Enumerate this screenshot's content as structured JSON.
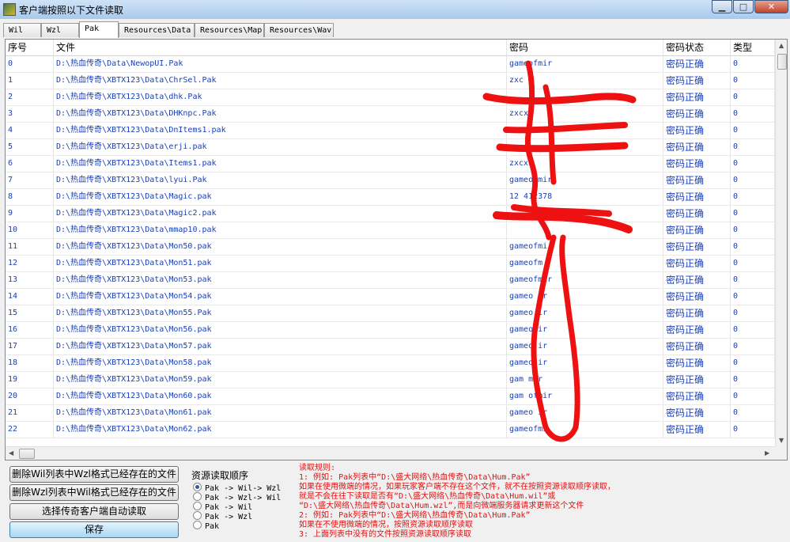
{
  "window": {
    "title": "客户端按照以下文件读取"
  },
  "tabs": [
    {
      "label": "Wil"
    },
    {
      "label": "Wzl"
    },
    {
      "label": "Pak"
    },
    {
      "label": "Resources\\Data"
    },
    {
      "label": "Resources\\Map"
    },
    {
      "label": "Resources\\Wav"
    }
  ],
  "active_tab": "Pak",
  "table": {
    "columns": [
      "序号",
      "文件",
      "密码",
      "密码状态",
      "类型"
    ],
    "rows": [
      {
        "no": "0",
        "file": "D:\\热血传奇\\Data\\NewopUI.Pak",
        "password": "gameofmir",
        "status": "密码正确",
        "type": "0"
      },
      {
        "no": "1",
        "file": "D:\\热血传奇\\XBTX123\\Data\\ChrSel.Pak",
        "password": "zxc",
        "status": "密码正确",
        "type": "0"
      },
      {
        "no": "2",
        "file": "D:\\热血传奇\\XBTX123\\Data\\dhk.Pak",
        "password": "",
        "status": "密码正确",
        "type": "0"
      },
      {
        "no": "3",
        "file": "D:\\热血传奇\\XBTX123\\Data\\DHKnpc.Pak",
        "password": "zxcxz",
        "status": "密码正确",
        "type": "0"
      },
      {
        "no": "4",
        "file": "D:\\热血传奇\\XBTX123\\Data\\DnItems1.pak",
        "password": "zx",
        "status": "密码正确",
        "type": "0"
      },
      {
        "no": "5",
        "file": "D:\\热血传奇\\XBTX123\\Data\\erji.pak",
        "password": "",
        "status": "密码正确",
        "type": "0"
      },
      {
        "no": "6",
        "file": "D:\\热血传奇\\XBTX123\\Data\\Items1.pak",
        "password": "zxcxz",
        "status": "密码正确",
        "type": "0"
      },
      {
        "no": "7",
        "file": "D:\\热血传奇\\XBTX123\\Data\\lyui.Pak",
        "password": "gameofmir",
        "status": "密码正确",
        "type": "0"
      },
      {
        "no": "8",
        "file": "D:\\热血传奇\\XBTX123\\Data\\Magic.pak",
        "password": "12 412378",
        "status": "密码正确",
        "type": "0"
      },
      {
        "no": "9",
        "file": "D:\\热血传奇\\XBTX123\\Data\\Magic2.pak",
        "password": "",
        "status": "密码正确",
        "type": "0"
      },
      {
        "no": "10",
        "file": "D:\\热血传奇\\XBTX123\\Data\\mmap10.pak",
        "password": "",
        "status": "密码正确",
        "type": "0"
      },
      {
        "no": "11",
        "file": "D:\\热血传奇\\XBTX123\\Data\\Mon50.pak",
        "password": "gameofmi",
        "status": "密码正确",
        "type": "0"
      },
      {
        "no": "12",
        "file": "D:\\热血传奇\\XBTX123\\Data\\Mon51.pak",
        "password": "gameofm",
        "status": "密码正确",
        "type": "0"
      },
      {
        "no": "13",
        "file": "D:\\热血传奇\\XBTX123\\Data\\Mon53.pak",
        "password": "gameofmir",
        "status": "密码正确",
        "type": "0"
      },
      {
        "no": "14",
        "file": "D:\\热血传奇\\XBTX123\\Data\\Mon54.pak",
        "password": "gameo ir",
        "status": "密码正确",
        "type": "0"
      },
      {
        "no": "15",
        "file": "D:\\热血传奇\\XBTX123\\Data\\Mon55.Pak",
        "password": "gameo ir",
        "status": "密码正确",
        "type": "0"
      },
      {
        "no": "16",
        "file": "D:\\热血传奇\\XBTX123\\Data\\Mon56.pak",
        "password": "gameo ir",
        "status": "密码正确",
        "type": "0"
      },
      {
        "no": "17",
        "file": "D:\\热血传奇\\XBTX123\\Data\\Mon57.pak",
        "password": "gameo ir",
        "status": "密码正确",
        "type": "0"
      },
      {
        "no": "18",
        "file": "D:\\热血传奇\\XBTX123\\Data\\Mon58.pak",
        "password": "gameo ir",
        "status": "密码正确",
        "type": "0"
      },
      {
        "no": "19",
        "file": "D:\\热血传奇\\XBTX123\\Data\\Mon59.pak",
        "password": "gam mir",
        "status": "密码正确",
        "type": "0"
      },
      {
        "no": "20",
        "file": "D:\\热血传奇\\XBTX123\\Data\\Mon60.pak",
        "password": "gam ofmir",
        "status": "密码正确",
        "type": "0"
      },
      {
        "no": "21",
        "file": "D:\\热血传奇\\XBTX123\\Data\\Mon61.pak",
        "password": "gameo ir",
        "status": "密码正确",
        "type": "0"
      },
      {
        "no": "22",
        "file": "D:\\热血传奇\\XBTX123\\Data\\Mon62.pak",
        "password": "gameofmi",
        "status": "密码正确",
        "type": "0"
      }
    ]
  },
  "buttons": {
    "delete_wil": "删除Wil列表中Wzl格式已经存在的文件",
    "delete_wzl": "删除Wzl列表中Wil格式已经存在的文件",
    "select_client": "选择传奇客户端自动读取",
    "save": "保存"
  },
  "read_order": {
    "title": "资源读取顺序",
    "options": [
      "Pak -> Wil-> Wzl",
      "Pak -> Wzl-> Wil",
      "Pak -> Wil",
      "Pak -> Wzl",
      "Pak"
    ],
    "selected_index": 0
  },
  "rules": {
    "lines": [
      "读取规则:",
      "1: 例如: Pak列表中“D:\\盛大网络\\热血传奇\\Data\\Hum.Pak”",
      "   如果在使用微端的情况，如果玩家客户端不存在这个文件，就不在按照资源读取顺序读取，",
      "   就是不会在往下读取是否有“D:\\盛大网络\\热血传奇\\Data\\Hum.wil”或",
      "   “D:\\盛大网络\\热血传奇\\Data\\Hum.wzl”,而是向微端服务器请求更新这个文件",
      "2: 例如: Pak列表中“D:\\盛大网络\\热血传奇\\Data\\Hum.Pak”",
      "   如果在不使用微端的情况，按照资源读取顺序读取",
      "3: 上面列表中没有的文件按照资源读取顺序读取"
    ]
  },
  "colors": {
    "rule_text": "#e01010",
    "cell_text": "#1a3fb5",
    "scribble": "#ee1111"
  }
}
